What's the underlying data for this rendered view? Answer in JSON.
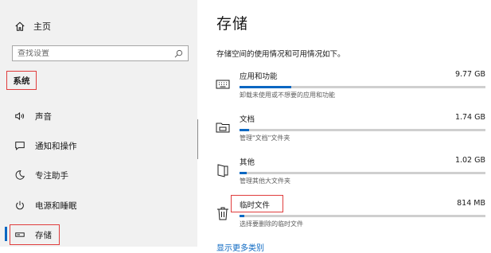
{
  "sidebar": {
    "home_label": "主页",
    "search_placeholder": "查找设置",
    "section_title": "系统",
    "items": [
      {
        "label": "声音",
        "icon": "speaker-icon"
      },
      {
        "label": "通知和操作",
        "icon": "notification-icon"
      },
      {
        "label": "专注助手",
        "icon": "moon-icon"
      },
      {
        "label": "电源和睡眠",
        "icon": "power-icon"
      },
      {
        "label": "存储",
        "icon": "storage-icon",
        "selected": true
      }
    ]
  },
  "main": {
    "title": "存储",
    "description": "存储空间的使用情况和可用情况如下。",
    "rows": [
      {
        "name": "应用和功能",
        "size": "9.77 GB",
        "sub": "卸载未使用或不想要的应用和功能",
        "usage_fraction": 0.21,
        "icon": "keyboard-icon"
      },
      {
        "name": "文档",
        "size": "1.74 GB",
        "sub": "管理\"文档\"文件夹",
        "usage_fraction": 0.04,
        "icon": "folder-icon"
      },
      {
        "name": "其他",
        "size": "1.02 GB",
        "sub": "管理其他大文件夹",
        "usage_fraction": 0.03,
        "icon": "file-icon"
      },
      {
        "name": "临时文件",
        "size": "814 MB",
        "sub": "选择要删除的临时文件",
        "usage_fraction": 0.02,
        "icon": "trash-icon"
      }
    ],
    "more_link": "显示更多类别"
  },
  "colors": {
    "accent": "#0a67c2",
    "highlight_box": "#e03c3c"
  }
}
